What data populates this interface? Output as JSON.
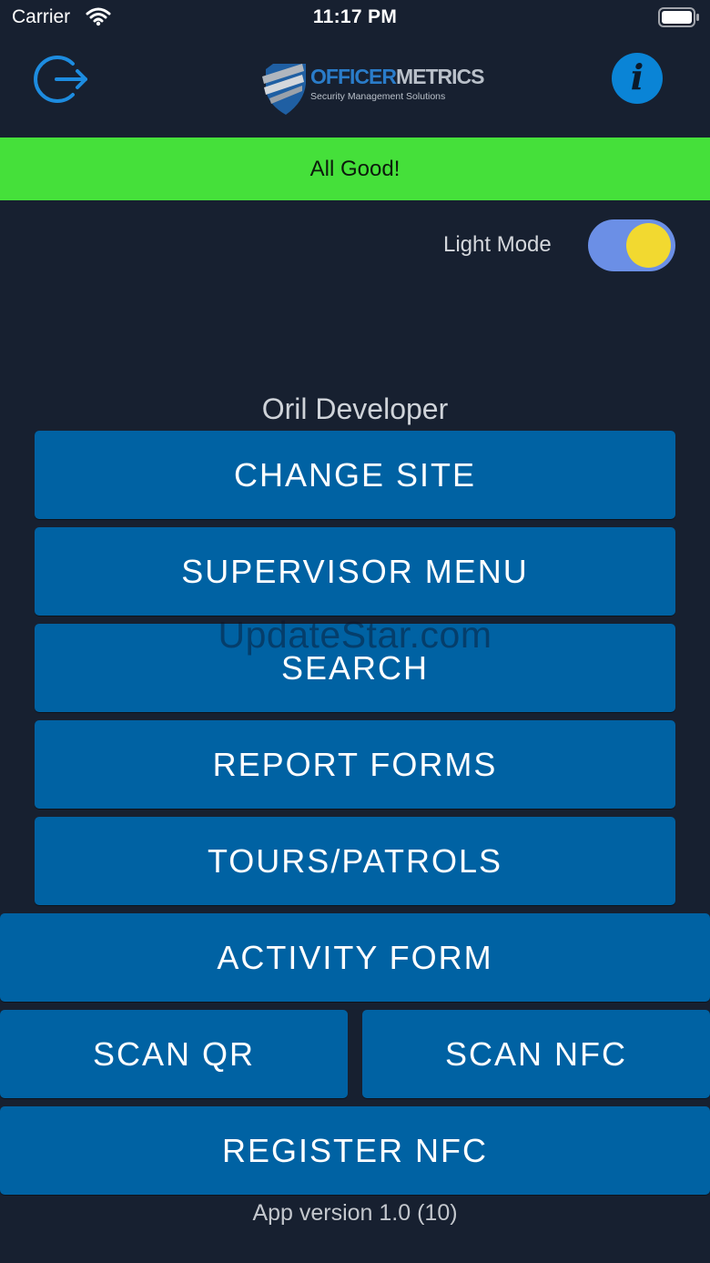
{
  "status_bar": {
    "carrier": "Carrier",
    "time": "11:17 PM"
  },
  "header": {
    "logo_primary": "OFFICER",
    "logo_secondary": "METRICS",
    "logo_tagline": "Security Management Solutions"
  },
  "banner": {
    "text": "All Good!",
    "color": "#45e03a"
  },
  "settings": {
    "light_mode_label": "Light Mode",
    "light_mode_on": true
  },
  "user": {
    "name": "Oril Developer"
  },
  "menu": {
    "change_site": "CHANGE SITE",
    "supervisor_menu": "SUPERVISOR MENU",
    "search": "SEARCH",
    "report_forms": "REPORT FORMS",
    "tours_patrols": "TOURS/PATROLS",
    "activity_form": "ACTIVITY FORM",
    "scan_qr": "SCAN QR",
    "scan_nfc": "SCAN NFC",
    "register_nfc": "REGISTER NFC"
  },
  "watermark": "UpdateStar.com",
  "footer": {
    "app_version": "App version 1.0 (10)"
  },
  "colors": {
    "background": "#172030",
    "button": "#0062a3",
    "accent": "#0a84d6"
  },
  "icons": [
    "wifi-icon",
    "battery-icon",
    "logout-icon",
    "info-icon",
    "shield-logo"
  ]
}
